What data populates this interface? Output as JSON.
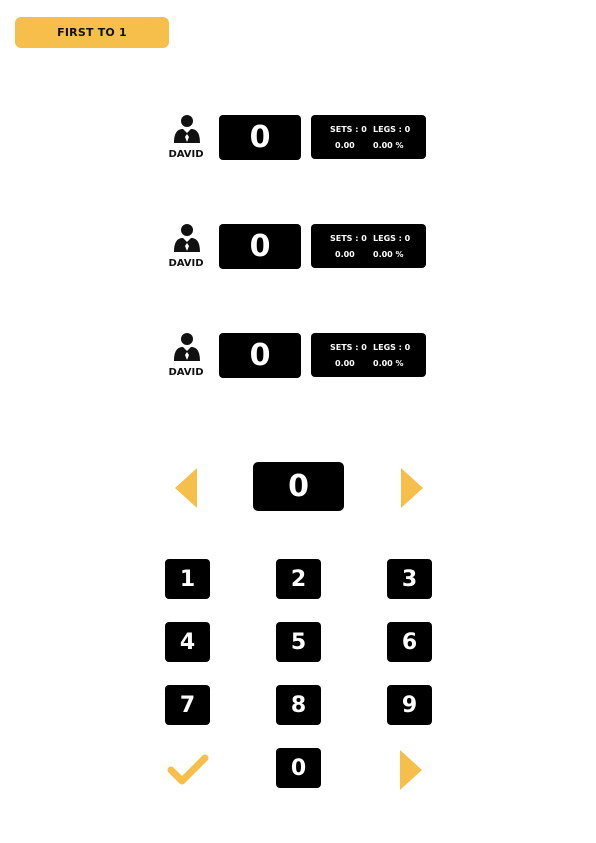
{
  "header": {
    "badge_label": "FIRST TO 1"
  },
  "players": [
    {
      "name": "DAVID",
      "score": "0",
      "sets_label": "SETS : 0",
      "legs_label": "LEGS : 0",
      "average": "0.00",
      "percent": "0.00 %"
    },
    {
      "name": "DAVID",
      "score": "0",
      "sets_label": "SETS : 0",
      "legs_label": "LEGS : 0",
      "average": "0.00",
      "percent": "0.00 %"
    },
    {
      "name": "DAVID",
      "score": "0",
      "sets_label": "SETS : 0",
      "legs_label": "LEGS : 0",
      "average": "0.00",
      "percent": "0.00 %"
    }
  ],
  "entry": {
    "value": "0"
  },
  "keypad": {
    "keys": [
      "1",
      "2",
      "3",
      "4",
      "5",
      "6",
      "7",
      "8",
      "9",
      "0"
    ]
  },
  "icons": {
    "user": "user-icon",
    "prev": "arrow-left-icon",
    "next": "arrow-right-icon",
    "confirm": "checkmark-icon",
    "submit": "arrow-right-icon"
  },
  "colors": {
    "accent": "#f6bf4b",
    "panel": "#000000",
    "text_on_panel": "#ffffff",
    "text": "#111111"
  }
}
